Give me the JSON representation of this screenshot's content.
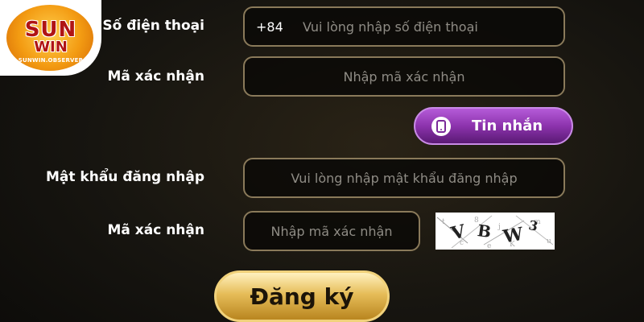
{
  "logo": {
    "line1": "SUN",
    "line2": "WIN",
    "domain": "SUNWIN.OBSERVER"
  },
  "form": {
    "phone": {
      "label": "Số điện thoại",
      "prefix": "+84",
      "placeholder": "Vui lòng nhập số điện thoại"
    },
    "sms_code": {
      "label": "Mã xác nhận",
      "placeholder": "Nhập mã xác nhận"
    },
    "sms_button": {
      "label": "Tin nhắn",
      "icon": "phone-icon"
    },
    "password": {
      "label": "Mật khẩu đăng nhập",
      "placeholder": "Vui lòng nhập mật khẩu đăng nhập"
    },
    "captcha_code": {
      "label": "Mã xác nhận",
      "placeholder": "Nhập mã xác nhận",
      "captcha_text": "VBW3"
    },
    "submit": {
      "label": "Đăng ký"
    }
  },
  "colors": {
    "background": "#171510",
    "sms_button": "#8c33ad",
    "submit_button": "#e6bd59"
  }
}
